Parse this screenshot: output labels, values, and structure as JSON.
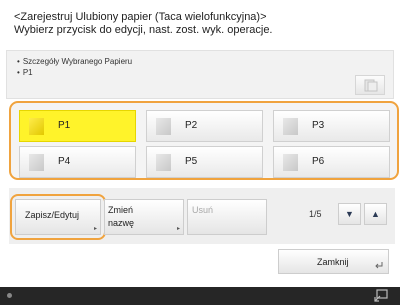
{
  "header": {
    "line1": "<Zarejestruj Ulubiony papier (Taca wielofunkcyjna)>",
    "line2": "Wybierz przycisk do edycji, nast. zost. wyk. operacje."
  },
  "details": {
    "bullet": "•",
    "line1": "Szczegóły Wybranego Papieru",
    "line2": "P1"
  },
  "papers": [
    {
      "label": "P1",
      "selected": true
    },
    {
      "label": "P2",
      "selected": false
    },
    {
      "label": "P3",
      "selected": false
    },
    {
      "label": "P4",
      "selected": false
    },
    {
      "label": "P5",
      "selected": false
    },
    {
      "label": "P6",
      "selected": false
    }
  ],
  "actions": {
    "edit": "Zapisz/Edytuj",
    "rename1": "Zmień",
    "rename2": "nazwę",
    "delete": "Usuń",
    "arrow": "▸"
  },
  "pagination": {
    "indicator": "1/5",
    "down": "▼",
    "up": "▲"
  },
  "close": {
    "label": "Zamknij"
  },
  "colors": {
    "accent": "#f0a33e",
    "selected": "#fff32a",
    "status_bar": "#262626"
  }
}
